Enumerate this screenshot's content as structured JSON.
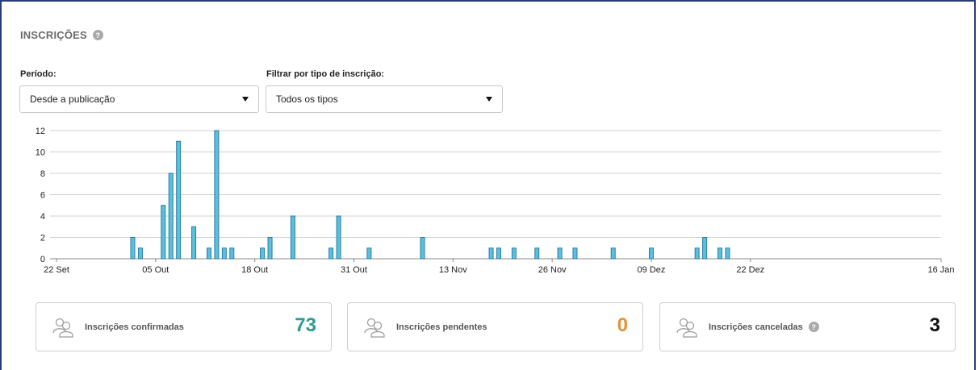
{
  "header": {
    "title": "INSCRIÇÕES",
    "help_glyph": "?"
  },
  "filters": {
    "period_label": "Período:",
    "period_value": "Desde a publicação",
    "type_label": "Filtrar por tipo de inscrição:",
    "type_value": "Todos os tipos"
  },
  "chart_data": {
    "type": "bar",
    "ylim": [
      0,
      12
    ],
    "yticks": [
      0,
      2,
      4,
      6,
      8,
      10,
      12
    ],
    "xlim": [
      "2023-09-22",
      "2024-01-16"
    ],
    "x_tick_labels": [
      "22 Set",
      "05 Out",
      "18 Out",
      "31 Out",
      "13 Nov",
      "26 Nov",
      "09 Dez",
      "22 Dez",
      "16 Jan"
    ],
    "x_tick_dates": [
      "2023-09-22",
      "2023-10-05",
      "2023-10-18",
      "2023-10-31",
      "2023-11-13",
      "2023-11-26",
      "2023-12-09",
      "2023-12-22",
      "2024-01-16"
    ],
    "grid": true,
    "bar_color": "#5bc0de",
    "bar_border": "#2a7ca3",
    "points": [
      {
        "x": "2023-10-02",
        "y": 2
      },
      {
        "x": "2023-10-03",
        "y": 1
      },
      {
        "x": "2023-10-06",
        "y": 5
      },
      {
        "x": "2023-10-07",
        "y": 8
      },
      {
        "x": "2023-10-08",
        "y": 11
      },
      {
        "x": "2023-10-10",
        "y": 3
      },
      {
        "x": "2023-10-12",
        "y": 1
      },
      {
        "x": "2023-10-13",
        "y": 12
      },
      {
        "x": "2023-10-14",
        "y": 1
      },
      {
        "x": "2023-10-15",
        "y": 1
      },
      {
        "x": "2023-10-19",
        "y": 1
      },
      {
        "x": "2023-10-20",
        "y": 2
      },
      {
        "x": "2023-10-23",
        "y": 4
      },
      {
        "x": "2023-10-28",
        "y": 1
      },
      {
        "x": "2023-10-29",
        "y": 4
      },
      {
        "x": "2023-11-02",
        "y": 1
      },
      {
        "x": "2023-11-09",
        "y": 2
      },
      {
        "x": "2023-11-18",
        "y": 1
      },
      {
        "x": "2023-11-19",
        "y": 1
      },
      {
        "x": "2023-11-21",
        "y": 1
      },
      {
        "x": "2023-11-24",
        "y": 1
      },
      {
        "x": "2023-11-27",
        "y": 1
      },
      {
        "x": "2023-11-29",
        "y": 1
      },
      {
        "x": "2023-12-04",
        "y": 1
      },
      {
        "x": "2023-12-09",
        "y": 1
      },
      {
        "x": "2023-12-15",
        "y": 1
      },
      {
        "x": "2023-12-16",
        "y": 2
      },
      {
        "x": "2023-12-18",
        "y": 1
      },
      {
        "x": "2023-12-19",
        "y": 1
      }
    ]
  },
  "cards": [
    {
      "label": "Inscrições confirmadas",
      "value": "73",
      "color": "#2a9d8f",
      "help": false
    },
    {
      "label": "Inscrições pendentes",
      "value": "0",
      "color": "#e69138",
      "help": false
    },
    {
      "label": "Inscrições canceladas",
      "value": "3",
      "color": "#111111",
      "help": true
    }
  ],
  "icons": {
    "card_icon": "users-icon",
    "dropdown_icon": "caret-down-icon",
    "help_icon": "help-icon"
  }
}
